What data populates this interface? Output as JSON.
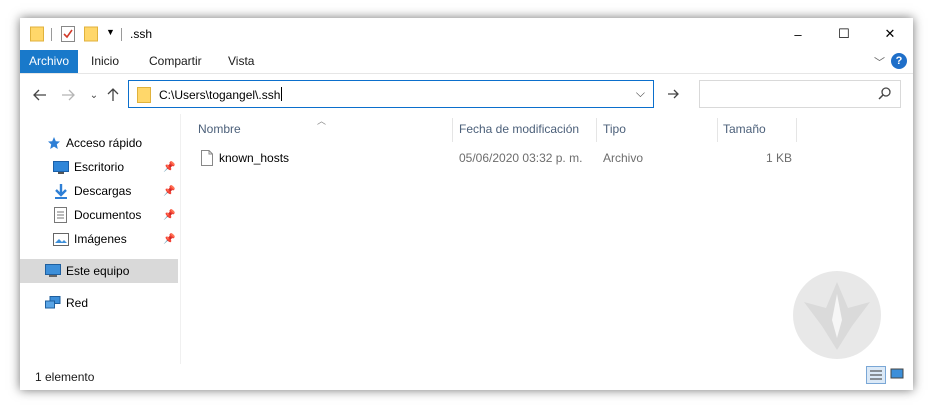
{
  "window": {
    "title": ".ssh",
    "controls": {
      "minimize": "–",
      "maximize": "☐",
      "close": "✕"
    }
  },
  "ribbon": {
    "tabs": [
      {
        "label": "Archivo",
        "active": true
      },
      {
        "label": "Inicio",
        "active": false
      },
      {
        "label": "Compartir",
        "active": false
      },
      {
        "label": "Vista",
        "active": false
      }
    ],
    "help": "?"
  },
  "navigation": {
    "address": "C:\\Users\\togangel\\.ssh",
    "search_placeholder": ""
  },
  "sidebar": {
    "quick_access": "Acceso rápido",
    "items": [
      {
        "label": "Escritorio",
        "icon": "desktop-icon"
      },
      {
        "label": "Descargas",
        "icon": "download-icon"
      },
      {
        "label": "Documentos",
        "icon": "documents-icon"
      },
      {
        "label": "Imágenes",
        "icon": "pictures-icon"
      }
    ],
    "this_pc": "Este equipo",
    "network": "Red"
  },
  "file_list": {
    "columns": [
      "Nombre",
      "Fecha de modificación",
      "Tipo",
      "Tamaño"
    ],
    "rows": [
      {
        "name": "known_hosts",
        "modified": "05/06/2020 03:32 p. m.",
        "type": "Archivo",
        "size": "1 KB"
      }
    ]
  },
  "status_bar": {
    "count": "1 elemento"
  },
  "colors": {
    "accent": "#1979ca",
    "selection": "#d9d9d9",
    "address_border": "#0b6fcc"
  }
}
